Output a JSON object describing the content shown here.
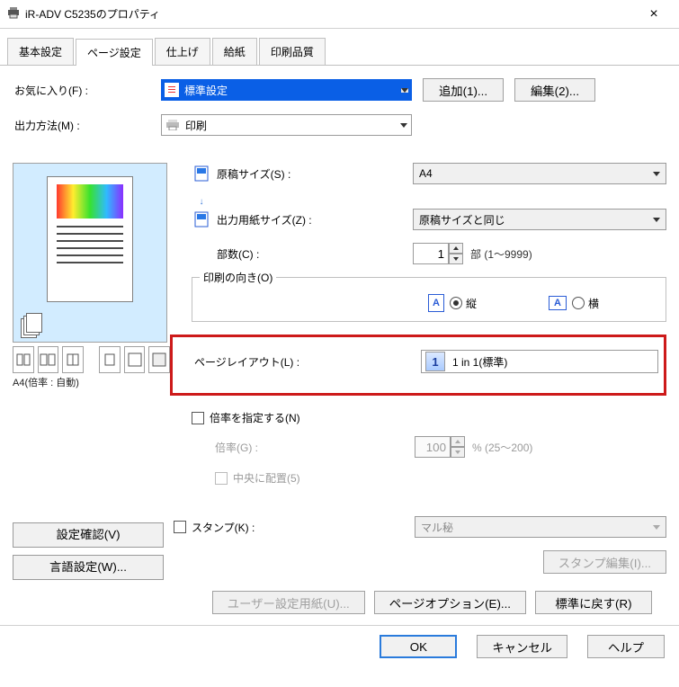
{
  "window": {
    "title": "iR-ADV C5235のプロパティ"
  },
  "tabs": [
    "基本設定",
    "ページ設定",
    "仕上げ",
    "給紙",
    "印刷品質"
  ],
  "activeTab": 1,
  "favorite": {
    "label": "お気に入り(F) :",
    "value": "標準設定",
    "add": "追加(1)...",
    "edit": "編集(2)..."
  },
  "outputMethod": {
    "label": "出力方法(M) :",
    "value": "印刷"
  },
  "previewCaption": "A4(倍率 : 自動)",
  "form": {
    "originalSize": {
      "label": "原稿サイズ(S) :",
      "value": "A4"
    },
    "outputSize": {
      "label": "出力用紙サイズ(Z) :",
      "value": "原稿サイズと同じ"
    },
    "copies": {
      "label": "部数(C) :",
      "value": "1",
      "suffix": "部 (1～9999)"
    },
    "orientation": {
      "legend": "印刷の向き(O)",
      "portrait": "縦",
      "landscape": "横"
    },
    "pageLayout": {
      "label": "ページレイアウト(L) :",
      "value": "1 in 1(標準)"
    },
    "scaleCheck": "倍率を指定する(N)",
    "scale": {
      "label": "倍率(G) :",
      "value": "100",
      "suffix": "% (25～200)"
    },
    "center": "中央に配置(5)",
    "stamp": {
      "label": "スタンプ(K) :",
      "value": "マル秘",
      "edit": "スタンプ編集(I)..."
    }
  },
  "sideButtons": {
    "confirm": "設定確認(V)",
    "lang": "言語設定(W)..."
  },
  "bottom": {
    "userPaper": "ユーザー設定用紙(U)...",
    "pageOptions": "ページオプション(E)...",
    "restore": "標準に戻す(R)"
  },
  "footer": {
    "ok": "OK",
    "cancel": "キャンセル",
    "help": "ヘルプ"
  }
}
